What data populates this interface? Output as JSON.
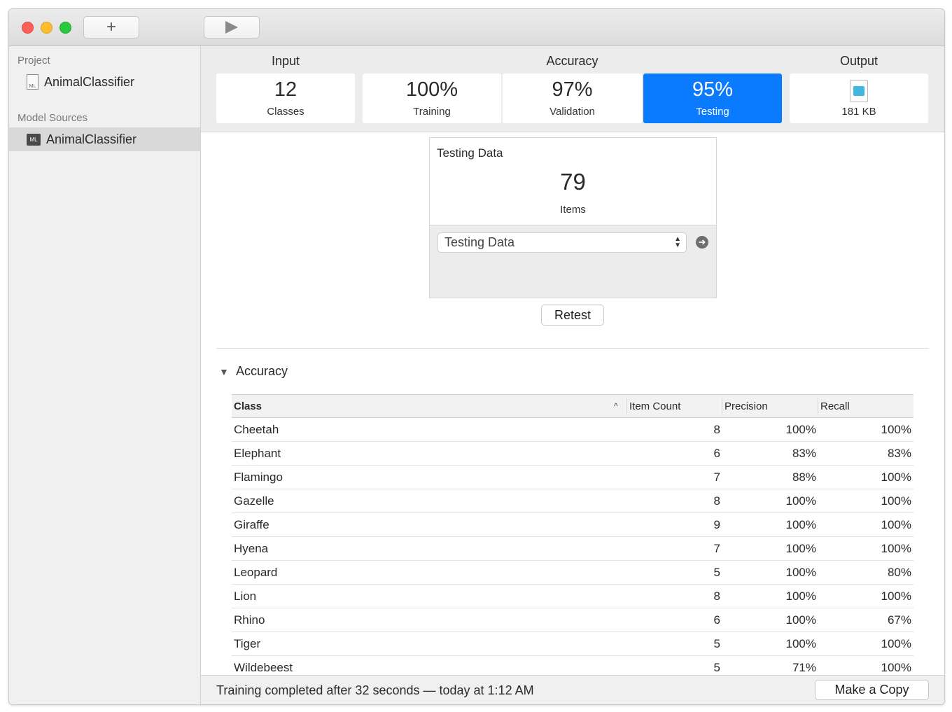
{
  "toolbar": {
    "add_icon": "plus-icon",
    "run_icon": "play-icon"
  },
  "sidebar": {
    "project_heading": "Project",
    "project_item": "AnimalClassifier",
    "sources_heading": "Model Sources",
    "source_item": "AnimalClassifier",
    "source_icon_text": "ML",
    "project_icon_text": "ML"
  },
  "metrics": {
    "input_label": "Input",
    "accuracy_label": "Accuracy",
    "output_label": "Output",
    "classes": {
      "value": "12",
      "label": "Classes"
    },
    "training": {
      "value": "100%",
      "label": "Training"
    },
    "validation": {
      "value": "97%",
      "label": "Validation"
    },
    "testing": {
      "value": "95%",
      "label": "Testing"
    },
    "output": {
      "value": "181 KB",
      "icon": "mlmodel-file-icon"
    },
    "active_color": "#0a7aff"
  },
  "testing_panel": {
    "title": "Testing Data",
    "count": "79",
    "unit": "Items",
    "select_value": "Testing Data",
    "retest_label": "Retest"
  },
  "accuracy_section": {
    "title": "Accuracy",
    "columns": {
      "class": "Class",
      "item_count": "Item Count",
      "precision": "Precision",
      "recall": "Recall"
    },
    "rows": [
      {
        "class": "Cheetah",
        "count": "8",
        "precision": "100%",
        "recall": "100%"
      },
      {
        "class": "Elephant",
        "count": "6",
        "precision": "83%",
        "recall": "83%"
      },
      {
        "class": "Flamingo",
        "count": "7",
        "precision": "88%",
        "recall": "100%"
      },
      {
        "class": "Gazelle",
        "count": "8",
        "precision": "100%",
        "recall": "100%"
      },
      {
        "class": "Giraffe",
        "count": "9",
        "precision": "100%",
        "recall": "100%"
      },
      {
        "class": "Hyena",
        "count": "7",
        "precision": "100%",
        "recall": "100%"
      },
      {
        "class": "Leopard",
        "count": "5",
        "precision": "100%",
        "recall": "80%"
      },
      {
        "class": "Lion",
        "count": "8",
        "precision": "100%",
        "recall": "100%"
      },
      {
        "class": "Rhino",
        "count": "6",
        "precision": "100%",
        "recall": "67%"
      },
      {
        "class": "Tiger",
        "count": "5",
        "precision": "100%",
        "recall": "100%"
      },
      {
        "class": "Wildebeest",
        "count": "5",
        "precision": "71%",
        "recall": "100%"
      }
    ]
  },
  "status": {
    "text": "Training completed after 32 seconds — today at 1:12 AM",
    "copy_button": "Make a Copy"
  }
}
